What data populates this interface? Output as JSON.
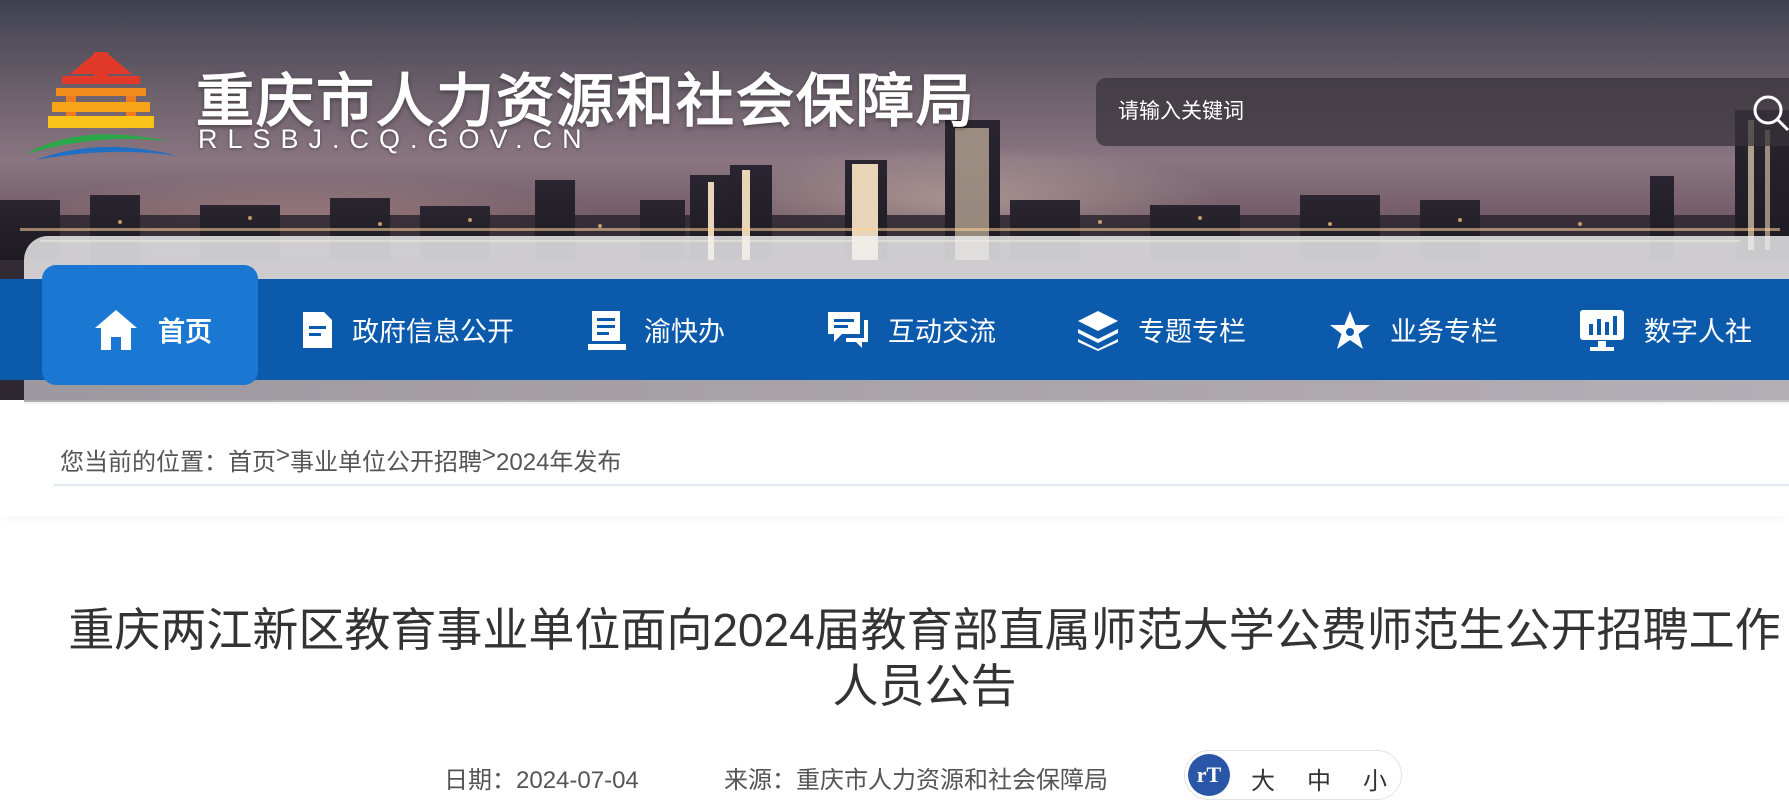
{
  "header": {
    "site_title": "重庆市人力资源和社会保障局",
    "site_domain": "RLSBJ.CQ.GOV.CN",
    "logo_icon": "temple-emblem-icon",
    "search": {
      "placeholder": "请输入关键词",
      "icon": "search-icon"
    }
  },
  "nav": {
    "bar_color": "#0c5aac",
    "active_color": "#1a78d2",
    "items": [
      {
        "label": "首页",
        "icon": "home-icon",
        "active": true
      },
      {
        "label": "政府信息公开",
        "icon": "document-icon"
      },
      {
        "label": "渝快办",
        "icon": "task-list-icon"
      },
      {
        "label": "互动交流",
        "icon": "chat-bubble-icon"
      },
      {
        "label": "专题专栏",
        "icon": "layers-icon"
      },
      {
        "label": "业务专栏",
        "icon": "star-icon"
      },
      {
        "label": "数字人社",
        "icon": "monitor-icon"
      }
    ]
  },
  "breadcrumb": {
    "prefix": "您当前的位置：",
    "items": [
      "首页",
      "事业单位公开招聘",
      "2024年发布"
    ],
    "separator": ">"
  },
  "article": {
    "title": "重庆两江新区教育事业单位面向2024届教育部直属师范大学公费师范生公开招聘工作人员公告",
    "date": "日期：2024-07-04",
    "source": "来源：重庆市人力资源和社会保障局",
    "font_size": {
      "icon_label": "rT",
      "large": "大",
      "medium": "中",
      "small": "小"
    }
  }
}
